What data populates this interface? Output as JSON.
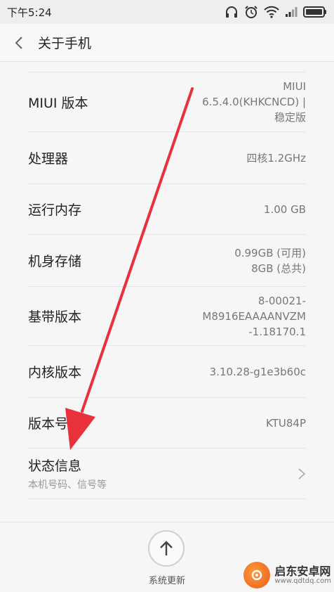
{
  "status_bar": {
    "time": "下午5:24",
    "icons": [
      "headphones-icon",
      "alarm-icon",
      "wifi-icon",
      "signal-icon",
      "battery-icon"
    ]
  },
  "header": {
    "back_icon": "chevron-left-icon",
    "title": "关于手机"
  },
  "rows": [
    {
      "label": "MIUI 版本",
      "value_lines": [
        "MIUI",
        "6.5.4.0(KHKCNCD) |",
        "稳定版"
      ]
    },
    {
      "label": "处理器",
      "value_lines": [
        "四核1.2GHz"
      ]
    },
    {
      "label": "运行内存",
      "value_lines": [
        "1.00 GB"
      ]
    },
    {
      "label": "机身存储",
      "value_lines": [
        "0.99GB (可用)",
        "8GB (总共)"
      ]
    },
    {
      "label": "基带版本",
      "value_lines": [
        "8-00021-",
        "M8916EAAAANVZM",
        "-1.18170.1"
      ]
    },
    {
      "label": "内核版本",
      "value_lines": [
        "3.10.28-g1e3b60c"
      ]
    },
    {
      "label": "版本号",
      "value_lines": [
        "KTU84P"
      ]
    },
    {
      "label": "状态信息",
      "subtitle": "本机号码、信号等",
      "icon": "chevron-right-icon"
    }
  ],
  "bottom": {
    "update_icon": "arrow-up-icon",
    "update_label": "系统更新"
  },
  "watermark": {
    "name": "启东安卓网",
    "url": "www.qdtdq.com"
  },
  "colors": {
    "annotation_arrow": "#e8313b",
    "background": "#f6f6f6",
    "watermark_orange": "#e85a1a"
  }
}
